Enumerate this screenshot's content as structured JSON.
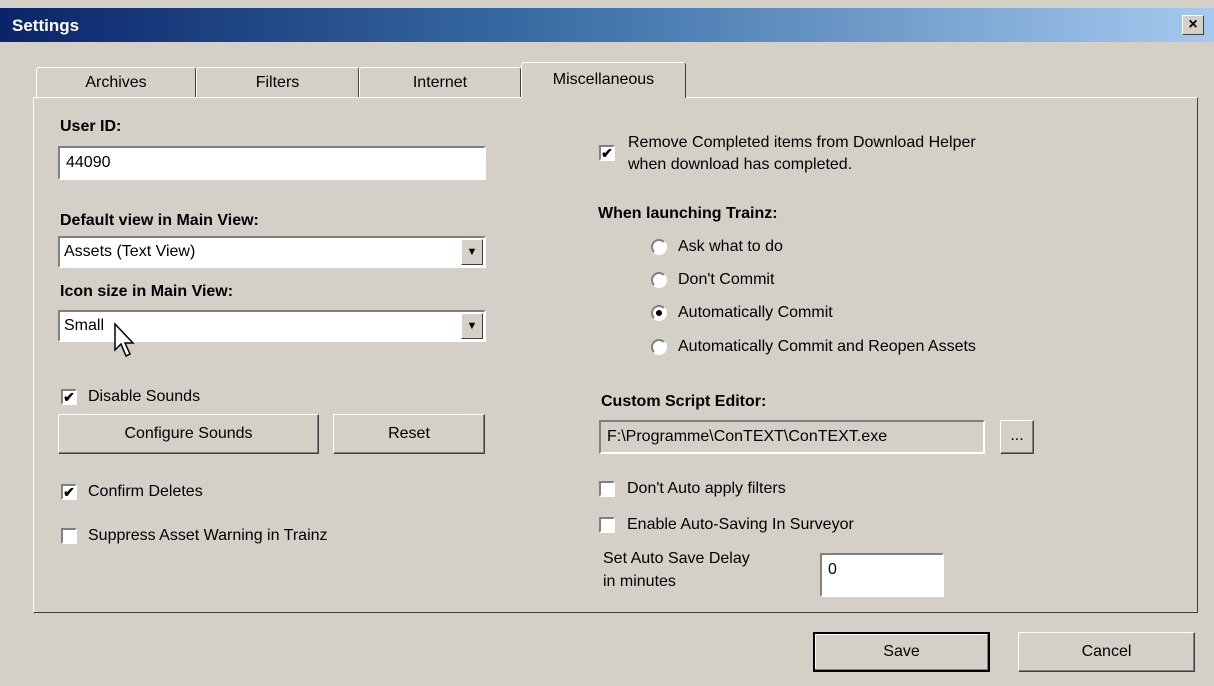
{
  "window": {
    "title": "Settings",
    "close_label": "×"
  },
  "tabs": [
    {
      "label": "Archives",
      "active": false
    },
    {
      "label": "Filters",
      "active": false
    },
    {
      "label": "Internet",
      "active": false
    },
    {
      "label": "Miscellaneous",
      "active": true
    }
  ],
  "left": {
    "user_id_label": "User ID:",
    "user_id_value": "44090",
    "default_view_label": "Default view in Main View:",
    "default_view_value": "Assets (Text View)",
    "icon_size_label": "Icon size in Main View:",
    "icon_size_value": "Small",
    "disable_sounds_label": "Disable Sounds",
    "disable_sounds_checked": true,
    "configure_sounds_label": "Configure Sounds",
    "reset_label": "Reset",
    "confirm_deletes_label": "Confirm Deletes",
    "confirm_deletes_checked": true,
    "suppress_warning_label": "Suppress Asset Warning in Trainz",
    "suppress_warning_checked": false
  },
  "right": {
    "remove_completed_line1": "Remove Completed items from Download Helper",
    "remove_completed_line2": "when download has completed.",
    "remove_completed_checked": true,
    "launching_label": "When launching Trainz:",
    "launch_options": [
      {
        "label": "Ask what to do",
        "selected": false
      },
      {
        "label": "Don't Commit",
        "selected": false
      },
      {
        "label": "Automatically Commit",
        "selected": true
      },
      {
        "label": "Automatically Commit and Reopen Assets",
        "selected": false
      }
    ],
    "script_editor_label": "Custom Script Editor:",
    "script_editor_value": "F:\\Programme\\ConTEXT\\ConTEXT.exe",
    "browse_label": "...",
    "dont_auto_apply_label": "Don't Auto apply filters",
    "dont_auto_apply_checked": false,
    "auto_saving_label": "Enable Auto-Saving In Surveyor",
    "auto_saving_checked": false,
    "auto_save_delay_line1": "Set Auto Save Delay",
    "auto_save_delay_line2": "in minutes",
    "auto_save_delay_value": "0"
  },
  "footer": {
    "save_label": "Save",
    "cancel_label": "Cancel"
  },
  "check_glyph": "✔"
}
